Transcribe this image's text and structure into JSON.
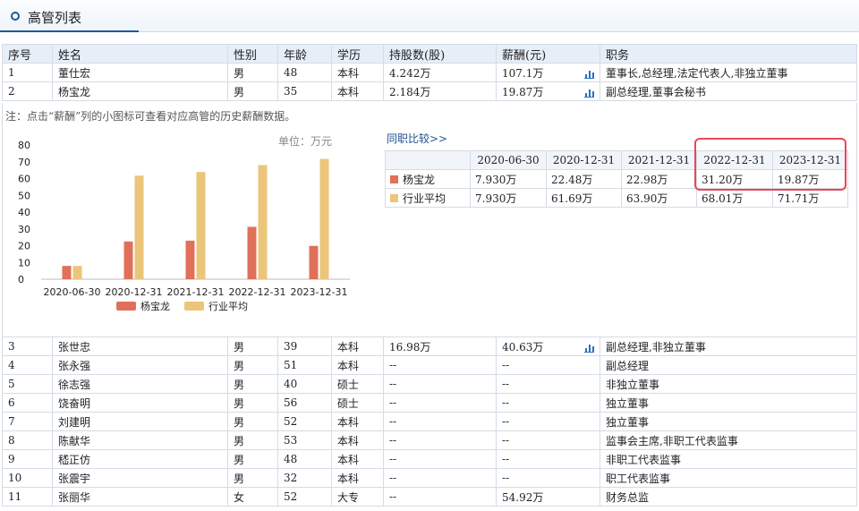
{
  "panel": {
    "title": "高管列表"
  },
  "columns": [
    "序号",
    "姓名",
    "性别",
    "年龄",
    "学历",
    "持股数(股)",
    "薪酬(元)",
    "职务"
  ],
  "rows_top": [
    {
      "no": "1",
      "name": "董仕宏",
      "gender": "男",
      "age": "48",
      "edu": "本科",
      "shares": "4.242万",
      "pay": "107.1万",
      "chart_icon": true,
      "title": "董事长,总经理,法定代表人,非独立董事"
    },
    {
      "no": "2",
      "name": "杨宝龙",
      "gender": "男",
      "age": "35",
      "edu": "本科",
      "shares": "2.184万",
      "pay": "19.87万",
      "chart_icon": true,
      "title": "副总经理,董事会秘书"
    }
  ],
  "note": "注：点击“薪酬”列的小图标可查看对应高管的历史薪酬数据。",
  "unit_label": "单位：万元",
  "compare_link": "同职比较>>",
  "compare": {
    "dates": [
      "2020-06-30",
      "2020-12-31",
      "2021-12-31",
      "2022-12-31",
      "2023-12-31"
    ],
    "rows": [
      {
        "label": "杨宝龙",
        "color": "#e0705a",
        "values": [
          "7.930万",
          "22.48万",
          "22.98万",
          "31.20万",
          "19.87万"
        ]
      },
      {
        "label": "行业平均",
        "color": "#ebc57a",
        "values": [
          "7.930万",
          "61.69万",
          "63.90万",
          "68.01万",
          "71.71万"
        ]
      }
    ]
  },
  "chart_data": {
    "type": "bar",
    "categories": [
      "2020-06-30",
      "2020-12-31",
      "2021-12-31",
      "2022-12-31",
      "2023-12-31"
    ],
    "series": [
      {
        "name": "杨宝龙",
        "color": "#e0705a",
        "values": [
          7.93,
          22.48,
          22.98,
          31.2,
          19.87
        ]
      },
      {
        "name": "行业平均",
        "color": "#ebc57a",
        "values": [
          7.93,
          61.69,
          63.9,
          68.01,
          71.71
        ]
      }
    ],
    "yticks": [
      0,
      10,
      20,
      30,
      40,
      50,
      60,
      70,
      80
    ],
    "ylim": [
      0,
      80
    ],
    "legend": "bottom"
  },
  "rows_bottom": [
    {
      "no": "3",
      "name": "张世忠",
      "gender": "男",
      "age": "39",
      "edu": "本科",
      "shares": "16.98万",
      "pay": "40.63万",
      "chart_icon": true,
      "title": "副总经理,非独立董事"
    },
    {
      "no": "4",
      "name": "张永强",
      "gender": "男",
      "age": "51",
      "edu": "本科",
      "shares": "--",
      "pay": "--",
      "chart_icon": false,
      "title": "副总经理"
    },
    {
      "no": "5",
      "name": "徐志强",
      "gender": "男",
      "age": "40",
      "edu": "硕士",
      "shares": "--",
      "pay": "--",
      "chart_icon": false,
      "title": "非独立董事"
    },
    {
      "no": "6",
      "name": "饶奋明",
      "gender": "男",
      "age": "56",
      "edu": "硕士",
      "shares": "--",
      "pay": "--",
      "chart_icon": false,
      "title": "独立董事"
    },
    {
      "no": "7",
      "name": "刘建明",
      "gender": "男",
      "age": "52",
      "edu": "本科",
      "shares": "--",
      "pay": "--",
      "chart_icon": false,
      "title": "独立董事"
    },
    {
      "no": "8",
      "name": "陈献华",
      "gender": "男",
      "age": "53",
      "edu": "本科",
      "shares": "--",
      "pay": "--",
      "chart_icon": false,
      "title": "监事会主席,非职工代表监事"
    },
    {
      "no": "9",
      "name": "嵇正仿",
      "gender": "男",
      "age": "48",
      "edu": "本科",
      "shares": "--",
      "pay": "--",
      "chart_icon": false,
      "title": "非职工代表监事"
    },
    {
      "no": "10",
      "name": "张震宇",
      "gender": "男",
      "age": "32",
      "edu": "本科",
      "shares": "--",
      "pay": "--",
      "chart_icon": false,
      "title": "职工代表监事"
    },
    {
      "no": "11",
      "name": "张丽华",
      "gender": "女",
      "age": "52",
      "edu": "大专",
      "shares": "--",
      "pay": "54.92万",
      "chart_icon": false,
      "title": "财务总监"
    }
  ]
}
